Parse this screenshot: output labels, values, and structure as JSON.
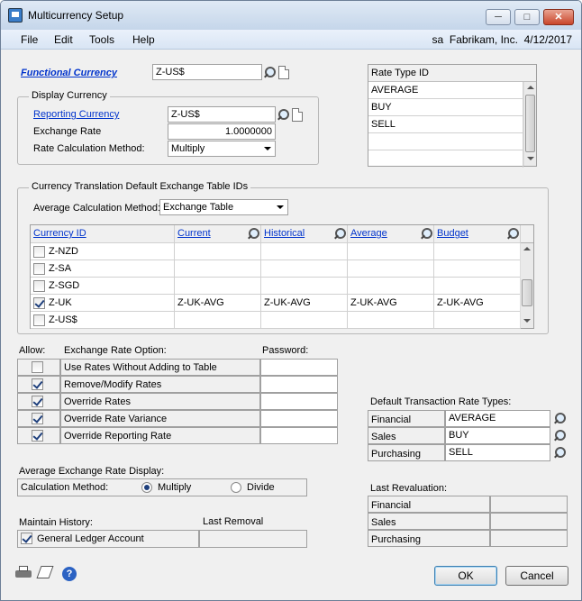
{
  "window": {
    "title": "Multicurrency Setup",
    "min": "─",
    "max": "□",
    "close": "✕"
  },
  "menu": {
    "items": [
      "File",
      "Edit",
      "Tools",
      "Help"
    ],
    "user": "sa",
    "company": "Fabrikam, Inc.",
    "date": "4/12/2017"
  },
  "functional": {
    "label": "Functional Currency",
    "value": "Z-US$"
  },
  "display": {
    "title": "Display Currency",
    "reporting_label": "Reporting Currency",
    "reporting_value": "Z-US$",
    "rate_label": "Exchange Rate",
    "rate_value": "1.0000000",
    "method_label": "Rate Calculation Method:",
    "method_value": "Multiply"
  },
  "rate_types": {
    "header": "Rate Type ID",
    "rows": [
      "AVERAGE",
      "BUY",
      "SELL",
      "",
      ""
    ]
  },
  "translation": {
    "title": "Currency Translation Default Exchange Table IDs",
    "avg_label": "Average Calculation Method:",
    "avg_value": "Exchange Table",
    "cols": [
      "Currency ID",
      "Current",
      "Historical",
      "Average",
      "Budget"
    ],
    "rows": [
      {
        "id": "Z-NZD",
        "checked": false,
        "v": [
          "",
          "",
          "",
          ""
        ]
      },
      {
        "id": "Z-SA",
        "checked": false,
        "v": [
          "",
          "",
          "",
          ""
        ]
      },
      {
        "id": "Z-SGD",
        "checked": false,
        "v": [
          "",
          "",
          "",
          ""
        ]
      },
      {
        "id": "Z-UK",
        "checked": true,
        "v": [
          "Z-UK-AVG",
          "Z-UK-AVG",
          "Z-UK-AVG",
          "Z-UK-AVG"
        ]
      },
      {
        "id": "Z-US$",
        "checked": false,
        "v": [
          "",
          "",
          "",
          ""
        ]
      }
    ]
  },
  "options": {
    "allow_label": "Allow:",
    "option_label": "Exchange Rate Option:",
    "password_label": "Password:",
    "rows": [
      {
        "label": "Use Rates Without Adding to Table",
        "checked": false
      },
      {
        "label": "Remove/Modify Rates",
        "checked": true
      },
      {
        "label": "Override Rates",
        "checked": true
      },
      {
        "label": "Override Rate Variance",
        "checked": true
      },
      {
        "label": "Override Reporting Rate",
        "checked": true
      }
    ]
  },
  "default_types": {
    "title": "Default Transaction Rate Types:",
    "rows": [
      {
        "label": "Financial",
        "value": "AVERAGE"
      },
      {
        "label": "Sales",
        "value": "BUY"
      },
      {
        "label": "Purchasing",
        "value": "SELL"
      }
    ]
  },
  "avg_display": {
    "title": "Average Exchange Rate Display:",
    "calc_label": "Calculation Method:",
    "multiply": "Multiply",
    "divide": "Divide",
    "selected": "Multiply"
  },
  "history": {
    "title": "Maintain History:",
    "last_removal": "Last Removal",
    "gl_label": "General Ledger Account",
    "gl_checked": true
  },
  "revaluation": {
    "title": "Last Revaluation:",
    "rows": [
      "Financial",
      "Sales",
      "Purchasing"
    ]
  },
  "buttons": {
    "ok": "OK",
    "cancel": "Cancel"
  }
}
